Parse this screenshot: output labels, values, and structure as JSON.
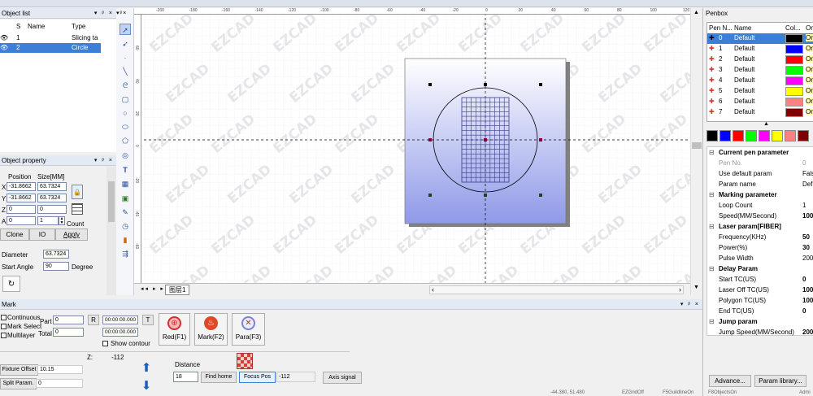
{
  "object_list": {
    "title": "Object list",
    "col_s": "S",
    "col_name": "Name",
    "col_type": "Type",
    "rows": [
      {
        "name": "1",
        "type": "Slicing ta"
      },
      {
        "name": "2",
        "type": "Circle"
      }
    ]
  },
  "object_property": {
    "title": "Object property",
    "pos_label": "Position",
    "size_label": "Size[MM]",
    "x_label": "X",
    "y_label": "Y",
    "z_label": "Z",
    "a_label": "A",
    "x_pos": "-31.8662",
    "x_size": "63.7324",
    "y_pos": "-31.8662",
    "y_size": "63.7324",
    "z_pos": "0",
    "z_size": "0",
    "a_pos": "0",
    "count_val": "1",
    "count_label": "Count",
    "clone": "Clone",
    "io": "IO",
    "apply": "Apply",
    "diameter_label": "Diameter",
    "diameter": "63.7324",
    "start_angle_label": "Start Angle",
    "start_angle": "90",
    "degree_label": "Degree"
  },
  "canvas": {
    "watermark": "EZCAD",
    "ruler_top": [
      "-200",
      "-180",
      "-160",
      "-140",
      "-120",
      "-100",
      "-80",
      "-60",
      "-40",
      "-20",
      "0",
      "20",
      "40",
      "60",
      "80",
      "100",
      "120"
    ],
    "ruler_left": [
      "60",
      "40",
      "20",
      "0",
      "-20",
      "-40",
      "-60"
    ],
    "tab_label": "图层1"
  },
  "mark": {
    "title": "Mark",
    "continuous": "Continuous",
    "mark_select": "Mark Select",
    "multilayer": "Multilayer",
    "part_label": "Part",
    "part_val": "0",
    "total_label": "Total",
    "total_val": "0",
    "r_label": "R",
    "t_label": "T",
    "time1": "00:00:00.000",
    "time2": "00:00:00.000",
    "show_contour": "Show contour",
    "red_btn": "Red(F1)",
    "mark_btn": "Mark(F2)",
    "para_btn": "Para(F3)",
    "z_label": "Z:",
    "z_val": "-112",
    "fixture_offset": "Fixture Offset",
    "fixture_val": "10.15",
    "split_param": "Split Param.",
    "split_val": "0",
    "distance_label": "Distance",
    "distance_val": "18",
    "find_home": "Find home",
    "focus_pos": "Focus Pos",
    "focus_val": "-112",
    "axis_signal": "Axis signal"
  },
  "penbox": {
    "title": "Penbox",
    "col_pen": "Pen N...",
    "col_name": "Name",
    "col_color": "Col...",
    "col_on": "On",
    "pens": [
      {
        "no": "0",
        "name": "Default",
        "color": "#000000",
        "on": "On"
      },
      {
        "no": "1",
        "name": "Default",
        "color": "#0000ff",
        "on": "On"
      },
      {
        "no": "2",
        "name": "Default",
        "color": "#ff0000",
        "on": "On"
      },
      {
        "no": "3",
        "name": "Default",
        "color": "#00ff00",
        "on": "On"
      },
      {
        "no": "4",
        "name": "Default",
        "color": "#ff00ff",
        "on": "On"
      },
      {
        "no": "5",
        "name": "Default",
        "color": "#ffff00",
        "on": "On"
      },
      {
        "no": "6",
        "name": "Default",
        "color": "#ff8080",
        "on": "On"
      },
      {
        "no": "7",
        "name": "Default",
        "color": "#800000",
        "on": "On"
      }
    ],
    "palette": [
      "#000000",
      "#0000ff",
      "#ff0000",
      "#00ff00",
      "#ff00ff",
      "#ffff00",
      "#ff8080",
      "#800000"
    ]
  },
  "params": [
    {
      "cat": "Current pen parameter"
    },
    {
      "k": "Pen No.",
      "v": "0",
      "dim": true
    },
    {
      "k": "Use default param",
      "v": "Fals"
    },
    {
      "k": "Param name",
      "v": "Def"
    },
    {
      "cat": "Marking parameter"
    },
    {
      "k": "Loop Count",
      "v": "1"
    },
    {
      "k": "Speed(MM/Second)",
      "v": "100",
      "b": true
    },
    {
      "cat": "Laser param[FIBER]"
    },
    {
      "k": "Frequency(KHz)",
      "v": "50",
      "b": true
    },
    {
      "k": "Power(%)",
      "v": "30",
      "b": true
    },
    {
      "k": "Pulse Width",
      "v": "200"
    },
    {
      "cat": "Delay Param"
    },
    {
      "k": "Start TC(US)",
      "v": "0",
      "b": true
    },
    {
      "k": "Laser Off TC(US)",
      "v": "100",
      "b": true
    },
    {
      "k": "Polygon TC(US)",
      "v": "100",
      "b": true
    },
    {
      "k": "End TC(US)",
      "v": "0",
      "b": true
    },
    {
      "cat": "Jump param"
    },
    {
      "k": "Jump Speed(MM/Second)",
      "v": "200",
      "b": true
    }
  ],
  "penbox_buttons": {
    "advance": "Advance...",
    "library": "Param library..."
  },
  "status": {
    "coords": "-44.380, 51.480",
    "grid": "EZGridOff",
    "guideline": "F5GuildlineOn",
    "object": "F8ObjectsOn",
    "user": "Admi"
  }
}
